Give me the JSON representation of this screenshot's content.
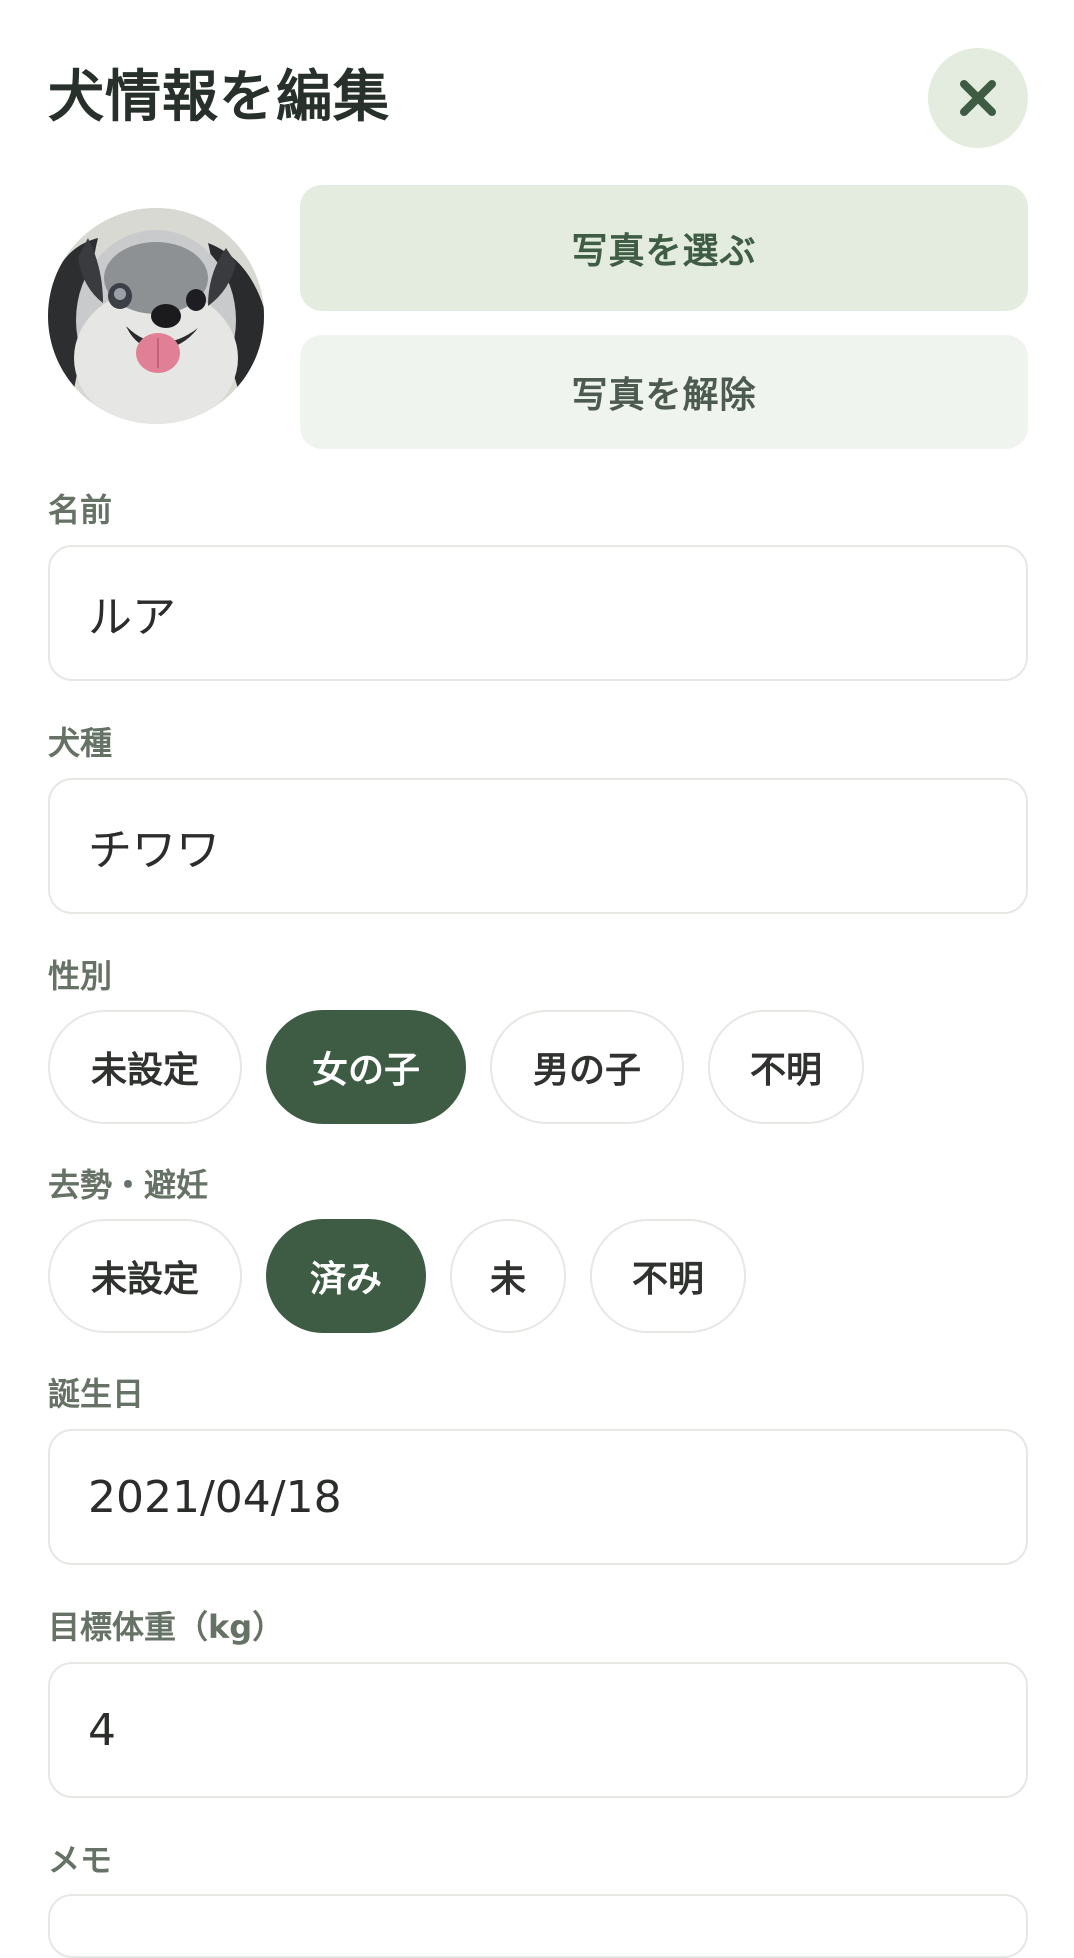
{
  "header": {
    "title": "犬情報を編集",
    "close_icon": "close-icon"
  },
  "photo": {
    "select_label": "写真を選ぶ",
    "remove_label": "写真を解除"
  },
  "form": {
    "name": {
      "label": "名前",
      "value": "ルア"
    },
    "breed": {
      "label": "犬種",
      "value": "チワワ"
    },
    "sex": {
      "label": "性別",
      "options": [
        "未設定",
        "女の子",
        "男の子",
        "不明"
      ],
      "selected": "女の子"
    },
    "neuter": {
      "label": "去勢・避妊",
      "options": [
        "未設定",
        "済み",
        "未",
        "不明"
      ],
      "selected": "済み"
    },
    "birthday": {
      "label": "誕生日",
      "value": "2021/04/18"
    },
    "target_weight": {
      "label": "目標体重（kg）",
      "value": "4"
    },
    "memo": {
      "label": "メモ"
    }
  },
  "colors": {
    "accent": "#3e5c44",
    "accent_light": "#e3ecdf",
    "label": "#677266"
  }
}
